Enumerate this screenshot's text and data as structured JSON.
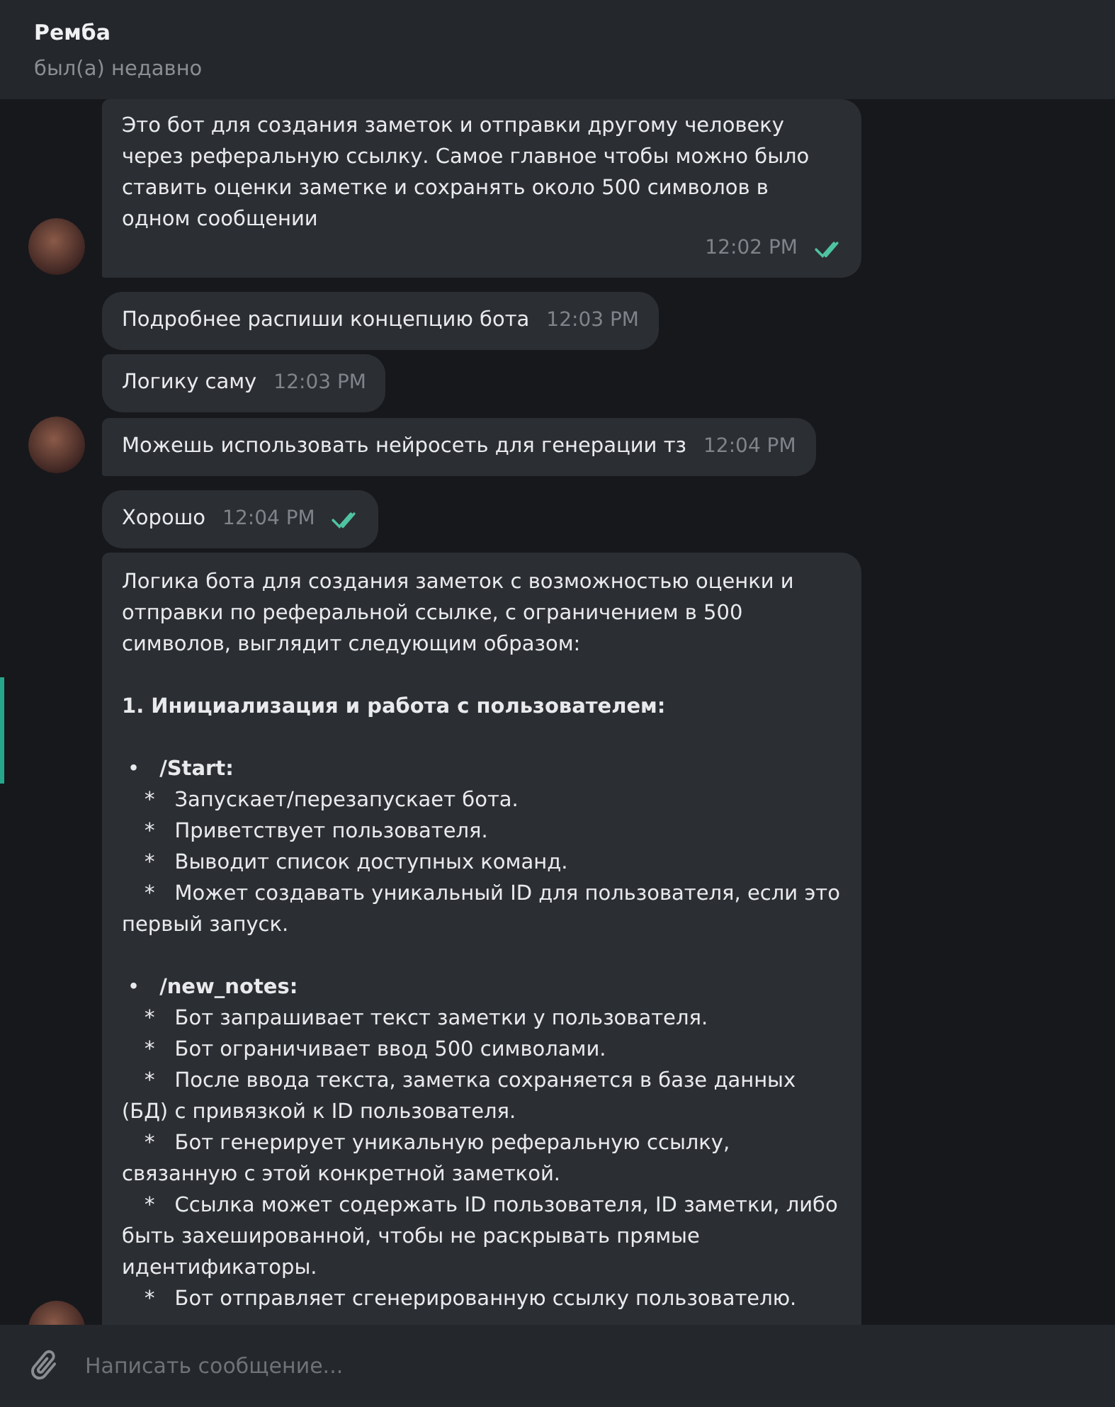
{
  "header": {
    "title": "Ремба",
    "status": "был(а) недавно"
  },
  "messages": [
    {
      "avatar": true,
      "paragraphs": [
        {
          "kind": "text",
          "text": "Это бот для создания заметок и отправки другому человеку через реферальную ссылку. Самое главное чтобы можно было ставить оценки заметке и сохранять около 500 символов в одном сообщении"
        }
      ],
      "time": "12:02 PM",
      "read": true,
      "group_start": false
    },
    {
      "avatar": false,
      "paragraphs": [
        {
          "kind": "text",
          "text": "Подробнее распиши концепцию бота"
        }
      ],
      "time": "12:03 PM",
      "group_start": true
    },
    {
      "avatar": false,
      "paragraphs": [
        {
          "kind": "text",
          "text": "Логику саму"
        }
      ],
      "time": "12:03 PM",
      "group_start": false
    },
    {
      "avatar": true,
      "paragraphs": [
        {
          "kind": "text",
          "text": "Можешь использовать нейросеть для генерации тз"
        }
      ],
      "time": "12:04 PM",
      "group_start": false
    },
    {
      "avatar": false,
      "paragraphs": [
        {
          "kind": "text",
          "text": "Хорошо"
        }
      ],
      "time": "12:04 PM",
      "read": true,
      "group_start": true
    },
    {
      "avatar": true,
      "group_start": false,
      "paragraphs": [
        {
          "kind": "text",
          "text": "Логика бота для создания заметок с возможностью оценки и отправки по реферальной ссылке, с ограничением в 500 символов, выглядит следующим образом:"
        },
        {
          "kind": "blank"
        },
        {
          "kind": "heading",
          "text": "1. Инициализация и работа с пользователем:"
        },
        {
          "kind": "blank"
        },
        {
          "kind": "bullet",
          "marker": "•",
          "text": "/Start:"
        },
        {
          "kind": "item",
          "marker": "*",
          "text": "Запускает/перезапускает бота."
        },
        {
          "kind": "item",
          "marker": "*",
          "text": "Приветствует пользователя."
        },
        {
          "kind": "item",
          "marker": "*",
          "text": "Выводит список доступных команд."
        },
        {
          "kind": "item",
          "marker": "*",
          "text": "Может создавать уникальный ID для пользователя, если это первый запуск."
        },
        {
          "kind": "blank"
        },
        {
          "kind": "bullet",
          "marker": "•",
          "text": "/new_notes:"
        },
        {
          "kind": "item",
          "marker": "*",
          "text": "Бот запрашивает текст заметки у пользователя."
        },
        {
          "kind": "item",
          "marker": "*",
          "text": "Бот ограничивает ввод 500 символами."
        },
        {
          "kind": "item",
          "marker": "*",
          "text": "После ввода текста, заметка сохраняется в базе данных (БД) с привязкой к ID пользователя."
        },
        {
          "kind": "item",
          "marker": "*",
          "text": "Бот генерирует уникальную реферальную ссылку, связанную с этой конкретной заметкой."
        },
        {
          "kind": "item",
          "marker": "*",
          "text": "Ссылка может содержать ID пользователя, ID заметки, либо быть захешированной, чтобы не раскрывать прямые идентификаторы."
        },
        {
          "kind": "item",
          "marker": "*",
          "text": "Бот отправляет сгенерированную ссылку пользователю."
        },
        {
          "kind": "blank"
        }
      ]
    }
  ],
  "composer": {
    "placeholder": "Написать сообщение..."
  }
}
